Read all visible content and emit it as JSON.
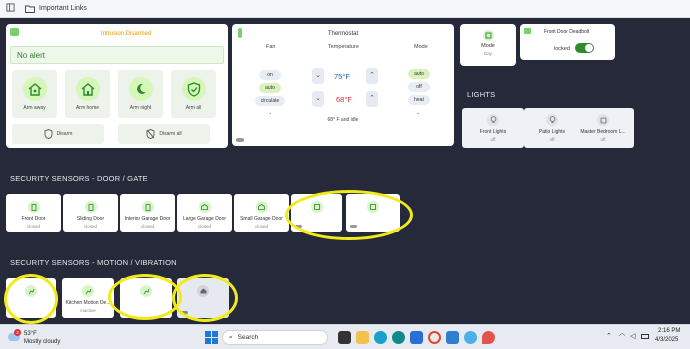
{
  "bookmarks": {
    "folder_label": "Important Links"
  },
  "alarm": {
    "status": "Intrusion Disarmed",
    "alert": "No alert",
    "buttons": [
      "Arm away",
      "Arm home",
      "Arm night",
      "Arm all"
    ],
    "disarm": "Disarm",
    "disarm_all": "Disarm all"
  },
  "thermostat": {
    "title": "Thermostat",
    "fan_label": "Fan",
    "fan_options": [
      "on",
      "auto",
      "circulate"
    ],
    "temp_label": "Temperature",
    "cool_setpoint": "75°F",
    "heat_setpoint": "68°F",
    "mode_label": "Mode",
    "mode_options": [
      "auto",
      "off",
      "heat"
    ],
    "status": "68° F and idle"
  },
  "mode_tile": {
    "label": "Mode",
    "value": "Day"
  },
  "deadbolt": {
    "name": "Front Door Deadbolt",
    "state": "locked"
  },
  "lights": {
    "heading": "LIGHTS",
    "items": [
      {
        "name": "Front Lights",
        "state": "off"
      },
      {
        "name": "Patio Lights",
        "state": "off"
      },
      {
        "name": "Master Bedroom L...",
        "state": "off"
      }
    ]
  },
  "door_section": {
    "heading": "SECURITY SENSORS - DOOR / GATE",
    "items": [
      {
        "name": "Front Door",
        "state": "closed"
      },
      {
        "name": "Sliding Door",
        "state": "closed"
      },
      {
        "name": "Interior Garage Door",
        "state": "closed"
      },
      {
        "name": "Large Garage Door",
        "state": "closed"
      },
      {
        "name": "Small Garage Door",
        "state": "closed"
      },
      {
        "name": "",
        "state": ""
      },
      {
        "name": "",
        "state": ""
      }
    ]
  },
  "motion_section": {
    "heading": "SECURITY SENSORS - MOTION / VIBRATION",
    "items": [
      {
        "name": "",
        "state": ""
      },
      {
        "name": "Kitchen Motion De...",
        "state": "inactive"
      },
      {
        "name": "",
        "state": ""
      },
      {
        "name": "",
        "state": ""
      }
    ]
  },
  "taskbar": {
    "weather_temp": "53°F",
    "weather_desc": "Mostly cloudy",
    "weather_badge": "3",
    "search_placeholder": "Search",
    "time": "2:16 PM",
    "date": "4/3/2025"
  },
  "colors": {
    "accent_green": "#d6f7b9",
    "toggle_green": "#2e8b2e",
    "highlight_yellow": "#f1ea1a",
    "setpoint_blue": "#1565c0",
    "setpoint_red": "#d32f2f"
  }
}
